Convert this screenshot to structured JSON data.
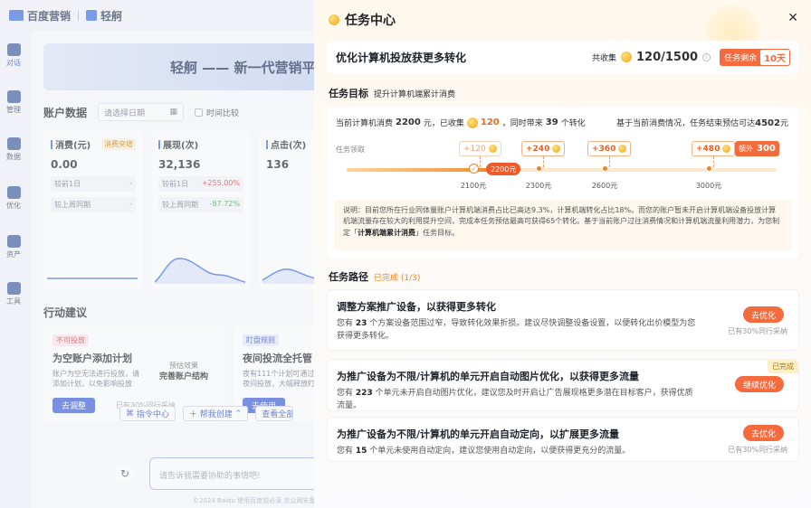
{
  "app": {
    "brand_main": "百度营销",
    "brand_product": "轻舸",
    "nav": [
      {
        "label": "对话"
      },
      {
        "label": "管理"
      },
      {
        "label": "数据"
      },
      {
        "label": "优化"
      },
      {
        "label": "资产"
      },
      {
        "label": "工具"
      }
    ],
    "banner_text": "轻舸 —— 新一代营销平",
    "account": {
      "title": "账户数据",
      "date_placeholder": "请选择日期",
      "compare_label": "时间比较"
    },
    "metrics": [
      {
        "name": "消费(元)",
        "tag": "消费突增",
        "value": "0.00",
        "row1": "较前1日",
        "row1_val": "-",
        "row2": "较上周同期",
        "row2_val": "-"
      },
      {
        "name": "展现(次)",
        "value": "32,136",
        "row1": "较前1日",
        "row1_val": "+255.00%",
        "row2": "较上周同期",
        "row2_val": "-87.72%"
      },
      {
        "name": "点击(次)",
        "value": "136",
        "row1": "较前1日",
        "row1_val": "",
        "row2": "较上周同期",
        "row2_val": ""
      }
    ],
    "suggestions_title": "行动建议",
    "suggestions": [
      {
        "badge": "不可投放",
        "title": "为空账户添加计划",
        "desc": "账户为空无法进行投放，请添加计划，以免影响投放",
        "expect_label": "预估效果",
        "expect_value": "完善账户结构",
        "button": "去调整",
        "note": "已有30%同行采纳"
      },
      {
        "badge": "盯盘规则",
        "title": "夜间投流全托管",
        "desc": "夜间投放，大幅释放盯",
        "desc_full": "夜间投放，大幅释放盯",
        "desc_prefix": "夜有111个计划可通过盯",
        "button": "去使用"
      }
    ],
    "chips": [
      "指令中心",
      "帮我创建",
      "查看全部"
    ],
    "chat_placeholder": "请告诉我需要协助的事情吧!",
    "footer": "©2024 Baidu 使用百度前必读 京公网安备1100"
  },
  "drawer": {
    "title": "任务中心",
    "close": "✕",
    "summary": {
      "title": "优化计算机投放获更多转化",
      "collected_label": "共收集",
      "collected_value": "120/1500",
      "remaining_label": "任务剩余",
      "remaining_value": "10天"
    },
    "goal": {
      "section": "任务目标",
      "section_sub": "提升计算机端累计消费",
      "line_prefix": "当前计算机消费",
      "spend": "2200",
      "line_mid": "元，已收集",
      "coins": "120",
      "line_mid2": "，同时带来",
      "conversions": "39",
      "line_suffix": "个转化",
      "right_prefix": "基于当前消费情况，任务结束预估可达",
      "right_value": "4502",
      "right_suffix": "元",
      "track_label": "任务领取",
      "current_tag": "2200元",
      "rewards": [
        "+120",
        "+240",
        "+360",
        "+480"
      ],
      "extra_label": "额外",
      "extra_value": "300",
      "ticks": [
        "2100元",
        "2300元",
        "2600元",
        "3000元"
      ],
      "progress": 0.37,
      "note_1": "说明：目前您所在行业同体量账户计算机端消费占比已高达9.3%，计算机端转化占比18%。而您的账户暂未开启计算机端设备投放计算机端流量存在较大的利用提升空间，完成本任务预估最高可获得65个转化。基于当前账户过往消费情况和计算机端流量利用潜力，为您制定「",
      "note_bold": "计算机端累计消费",
      "note_2": "」任务目标。"
    },
    "path": {
      "section": "任务路径",
      "status": "已完成 (1/3)",
      "tasks": [
        {
          "title": "调整方案推广设备，以获得更多转化",
          "desc_a": "您有",
          "num": "23",
          "desc_b": "个方案设备范围过窄，导致转化效果折损。建议尽快调整设备设置，以便转化出价模型为您获得更多转化。",
          "button": "去优化",
          "note": "已有30%同行采纳"
        },
        {
          "title": "为推广设备为不限/计算机的单元开启自动图片优化，以获得更多流量",
          "desc_a": "您有",
          "num": "223",
          "desc_b": "个单元未开启自动图片优化，建议您及时开启让广告展现格更多潜在目标客户，获得优质流量。",
          "button": "继续优化",
          "done_tag": "已完成"
        },
        {
          "title": "为推广设备为不限/计算机的单元开启自动定向，以扩展更多流量",
          "desc_a": "您有",
          "num": "15",
          "desc_b": "个单元未使用自动定向，建议您使用自动定向，以便获得更充分的流量。",
          "button": "去优化",
          "note": "已有30%同行采纳"
        }
      ]
    }
  }
}
